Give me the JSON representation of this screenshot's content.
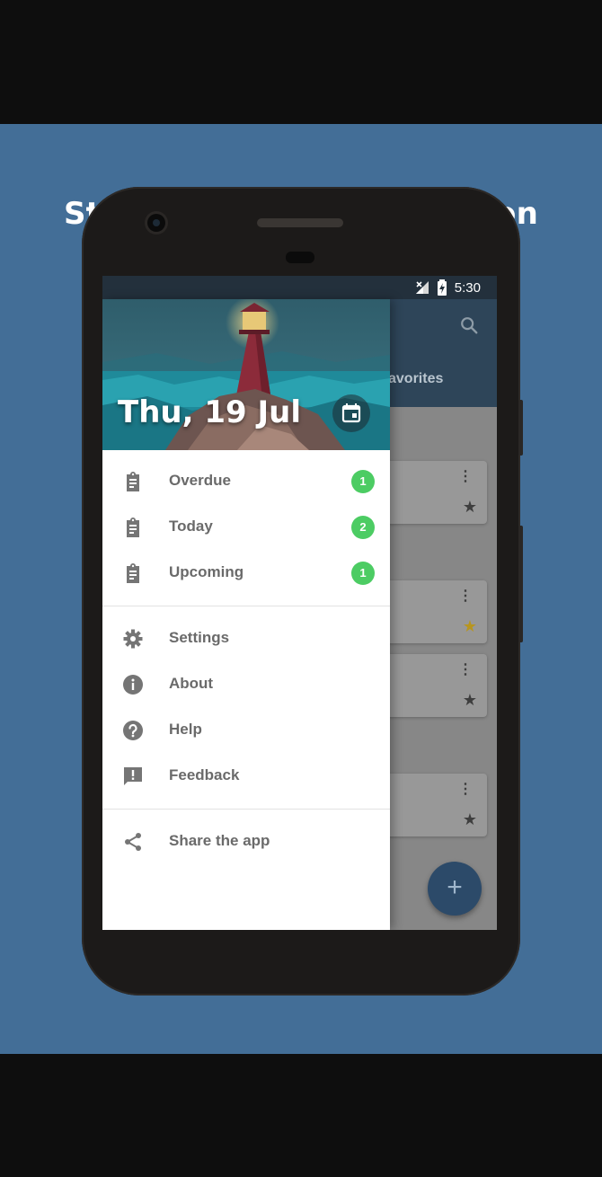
{
  "headline": "Straightforward navigation",
  "status_bar": {
    "time": "5:30"
  },
  "app": {
    "tab_visible_text": "avorites"
  },
  "drawer": {
    "date": "Thu, 19 Jul",
    "lists": [
      {
        "label": "Overdue",
        "count": "1",
        "icon": "clipboard-icon"
      },
      {
        "label": "Today",
        "count": "2",
        "icon": "clipboard-icon"
      },
      {
        "label": "Upcoming",
        "count": "1",
        "icon": "clipboard-icon"
      }
    ],
    "menu": [
      {
        "label": "Settings",
        "icon": "gear-icon"
      },
      {
        "label": "About",
        "icon": "info-icon"
      },
      {
        "label": "Help",
        "icon": "help-icon"
      },
      {
        "label": "Feedback",
        "icon": "feedback-icon"
      }
    ],
    "share": {
      "label": "Share the app",
      "icon": "share-icon"
    }
  },
  "fab": {
    "symbol": "+"
  },
  "colors": {
    "background": "#436e97",
    "badge": "#4ccc63",
    "toolbar": "#2e4559",
    "favorite_star": "#b7951f"
  }
}
